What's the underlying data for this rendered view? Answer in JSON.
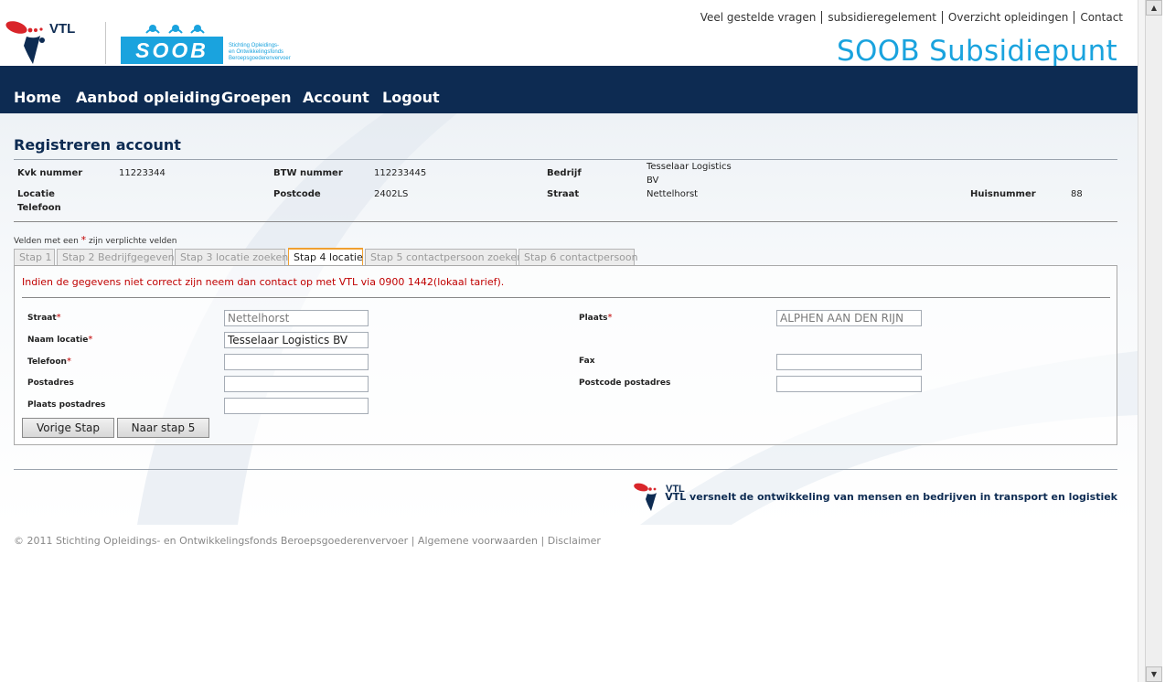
{
  "header": {
    "logo_vtl_text": "VTL",
    "logo_soob_text": "SOOB",
    "logo_soob_subtitle": [
      "Stichting Opleidings-",
      "en Ontwikkelingsfonds",
      "Beroepsgoederenvervoer"
    ],
    "top_links": [
      "Veel gestelde vragen",
      "subsidieregelement",
      "Overzicht opleidingen",
      "Contact"
    ],
    "brand_title": "SOOB Subsidiepunt"
  },
  "nav": {
    "items": [
      "Home",
      "Aanbod opleiding",
      "Groepen",
      "Account",
      "Logout"
    ]
  },
  "page": {
    "title": "Registreren account",
    "info": {
      "kvk_label": "Kvk nummer",
      "kvk_value": "11223344",
      "btw_label": "BTW nummer",
      "btw_value": "112233445",
      "bedrijf_label": "Bedrijf",
      "bedrijf_value_line1": "Tesselaar Logistics",
      "bedrijf_value_line2": "BV",
      "locatie_label": "Locatie",
      "telefoon_label": "Telefoon",
      "postcode_label": "Postcode",
      "postcode_value": "2402LS",
      "straat_label": "Straat",
      "straat_value": "Nettelhorst",
      "huisnummer_label": "Huisnummer",
      "huisnummer_value": "88"
    },
    "required_note_prefix": "Velden met een",
    "required_note_star": "*",
    "required_note_suffix": "zijn verplichte velden",
    "tabs": [
      {
        "label": "Stap 1",
        "active": false
      },
      {
        "label": "Stap 2 Bedrijfgegevens",
        "active": false
      },
      {
        "label": "Stap 3 locatie zoeken",
        "active": false
      },
      {
        "label": "Stap 4 locatie",
        "active": true
      },
      {
        "label": "Stap 5 contactpersoon zoeken",
        "active": false
      },
      {
        "label": "Stap 6 contactpersoon",
        "active": false
      }
    ],
    "error_message": "Indien de gegevens niet correct zijn neem dan contact op met VTL via 0900 1442(lokaal tarief).",
    "form": {
      "straat_label": "Straat",
      "straat_value": "Nettelhorst",
      "plaats_label": "Plaats",
      "plaats_value": "ALPHEN AAN DEN RIJN",
      "naam_label": "Naam locatie",
      "naam_value": "Tesselaar Logistics BV",
      "telefoon_label": "Telefoon",
      "telefoon_value": "",
      "fax_label": "Fax",
      "fax_value": "",
      "postadres_label": "Postadres",
      "postadres_value": "",
      "postcode_postadres_label": "Postcode postadres",
      "postcode_postadres_value": "",
      "plaats_postadres_label": "Plaats postadres",
      "plaats_postadres_value": "",
      "required_star": "*"
    },
    "buttons": {
      "prev": "Vorige Stap",
      "next": "Naar stap 5"
    }
  },
  "footer": {
    "logo_text": "VTL",
    "tagline": "VTL versnelt de ontwikkeling van mensen en bedrijven in transport en logistiek",
    "copyright": "© 2011 Stichting Opleidings- en Ontwikkelingsfonds Beroepsgoederenvervoer",
    "links": [
      "Algemene voorwaarden",
      "Disclaimer"
    ],
    "separator": "|"
  },
  "colors": {
    "nav_bg": "#0d2b52",
    "brand_blue": "#1aa3de",
    "error_red": "#c00000",
    "tab_active_border": "#f0a030"
  }
}
